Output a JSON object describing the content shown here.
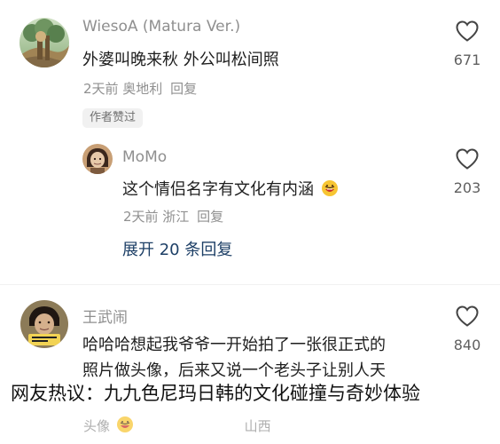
{
  "comments": [
    {
      "username": "WiesoA (Matura Ver.)",
      "text": "外婆叫晚来秋 外公叫松间照",
      "meta": "2天前 奥地利",
      "reply_label": "回复",
      "likes": "671",
      "author_badge": "作者赞过"
    },
    {
      "username": "MoMo",
      "text": "这个情侣名字有文化有内涵",
      "meta": "2天前 浙江",
      "reply_label": "回复",
      "likes": "203"
    },
    {
      "username": "王武闹",
      "text_line1": "哈哈哈想起我爷爷一开始拍了一张很正式的",
      "text_line2": "照片做头像，后来又说一个老头子让别人天",
      "likes": "840",
      "partial_line": "头像",
      "partial_meta": "山西"
    }
  ],
  "expand_replies": "展开 20 条回复",
  "caption": "网友热议：九九色尼玛日韩的文化碰撞与奇妙体验",
  "icons": {
    "like": "heart-outline-icon",
    "emoji": "grinning-face-icon"
  },
  "colors": {
    "link_blue": "#1d3f66",
    "meta_gray": "#909090",
    "username_gray": "#8f8f8f"
  }
}
